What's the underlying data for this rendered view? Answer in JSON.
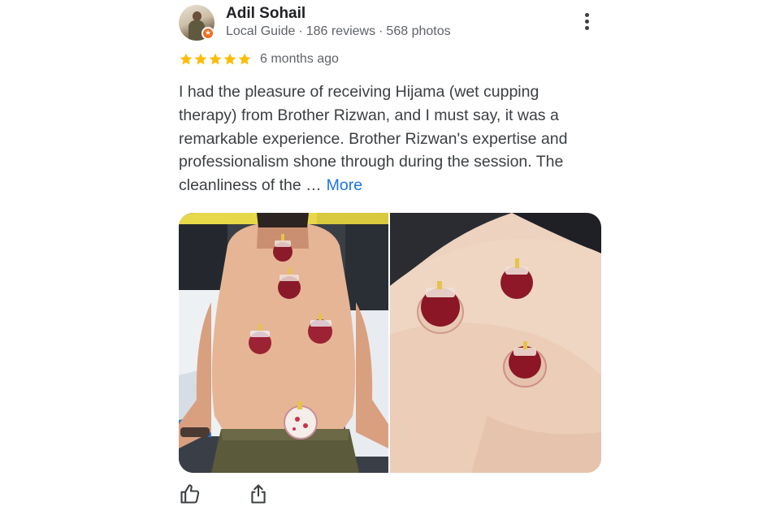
{
  "review": {
    "author_name": "Adil Sohail",
    "author_level": "Local Guide",
    "reviews_count": "186 reviews",
    "photos_count": "568 photos",
    "separator": "·",
    "rating": 5,
    "rating_max": 5,
    "time_ago": "6 months ago",
    "text": "I had the pleasure of receiving Hijama (wet cupping therapy) from Brother Rizwan, and I must say, it was a remarkable experience. Brother Rizwan's expertise and professionalism shone through during the session. The cleanliness of the …",
    "more_label": "More",
    "badge_icon": "local-guide-star-icon",
    "colors": {
      "star": "#fbbc04",
      "link": "#1a73e8",
      "badge": "#f26d21"
    }
  },
  "actions": {
    "like_icon": "thumbs-up-icon",
    "share_icon": "share-icon",
    "menu_icon": "more-vert-icon"
  }
}
